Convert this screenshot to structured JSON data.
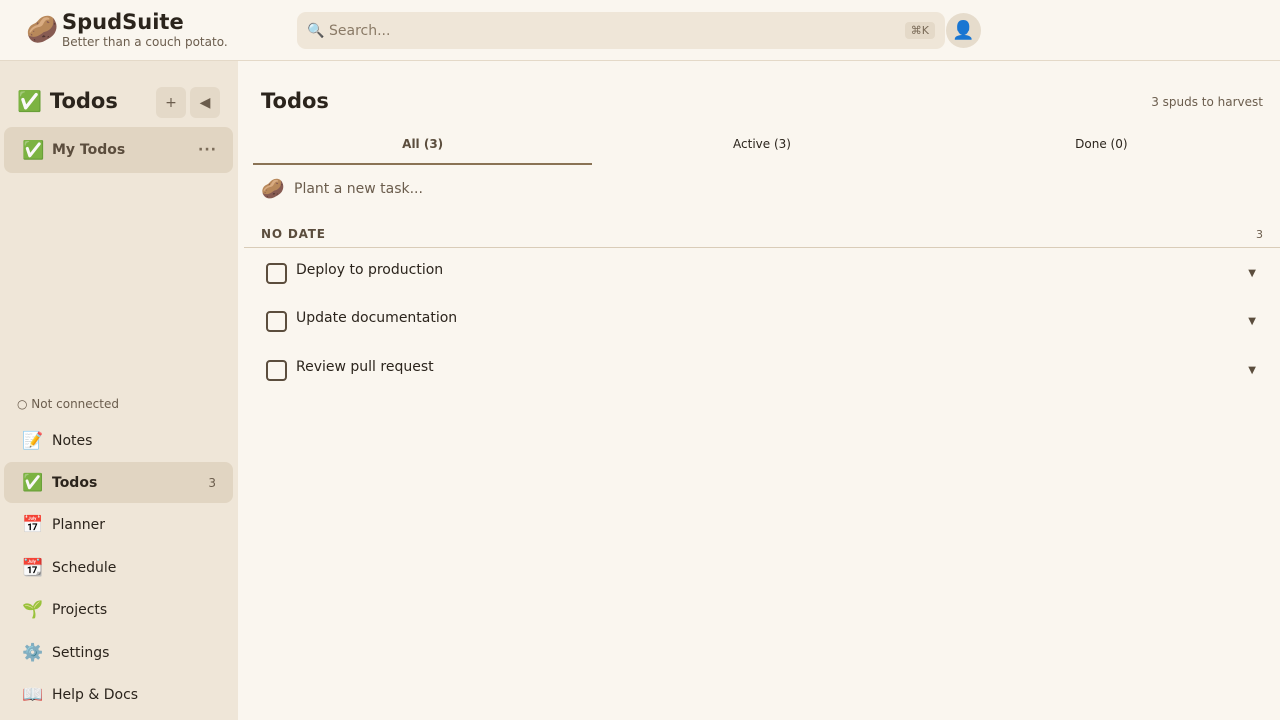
{
  "header": {
    "app_name": "SpudSuite",
    "tagline": "Better than a couch potato.",
    "logo_icon": "🥔",
    "search_placeholder": "Search...",
    "search_icon": "🔍",
    "search_shortcut": "⌘K",
    "avatar_icon": "👤"
  },
  "sidebar": {
    "title": "Todos",
    "title_icon": "✅",
    "add_label": "+",
    "collapse_label": "◀",
    "lists": [
      {
        "label": "My Todos",
        "icon": "✅",
        "more": "···"
      }
    ],
    "connection_status": "○ Not connected",
    "nav": [
      {
        "label": "Notes",
        "icon": "📝"
      },
      {
        "label": "Todos",
        "icon": "✅",
        "count": "3"
      },
      {
        "label": "Planner",
        "icon": "📅"
      },
      {
        "label": "Schedule",
        "icon": "📆"
      },
      {
        "label": "Projects",
        "icon": "🌱"
      },
      {
        "label": "Settings",
        "icon": "⚙️"
      },
      {
        "label": "Help & Docs",
        "icon": "📖"
      }
    ]
  },
  "main": {
    "title": "Todos",
    "summary": "3 spuds to harvest",
    "tabs": [
      {
        "label": "All (3)",
        "active": true
      },
      {
        "label": "Active (3)",
        "active": false
      },
      {
        "label": "Done (0)",
        "active": false
      }
    ],
    "new_task_icon": "🥔",
    "new_task_placeholder": "Plant a new task...",
    "group": {
      "label": "NO DATE",
      "count": "3"
    },
    "todos": [
      {
        "text": "Deploy to production",
        "done": false,
        "expand": "▼"
      },
      {
        "text": "Update documentation",
        "done": false,
        "expand": "▼"
      },
      {
        "text": "Review pull request",
        "done": false,
        "expand": "▼"
      }
    ]
  },
  "colors": {
    "background": "#faf6ef",
    "sidebar": "#efe6d8",
    "active_item": "#e1d5c2",
    "accent": "#8a7355"
  }
}
